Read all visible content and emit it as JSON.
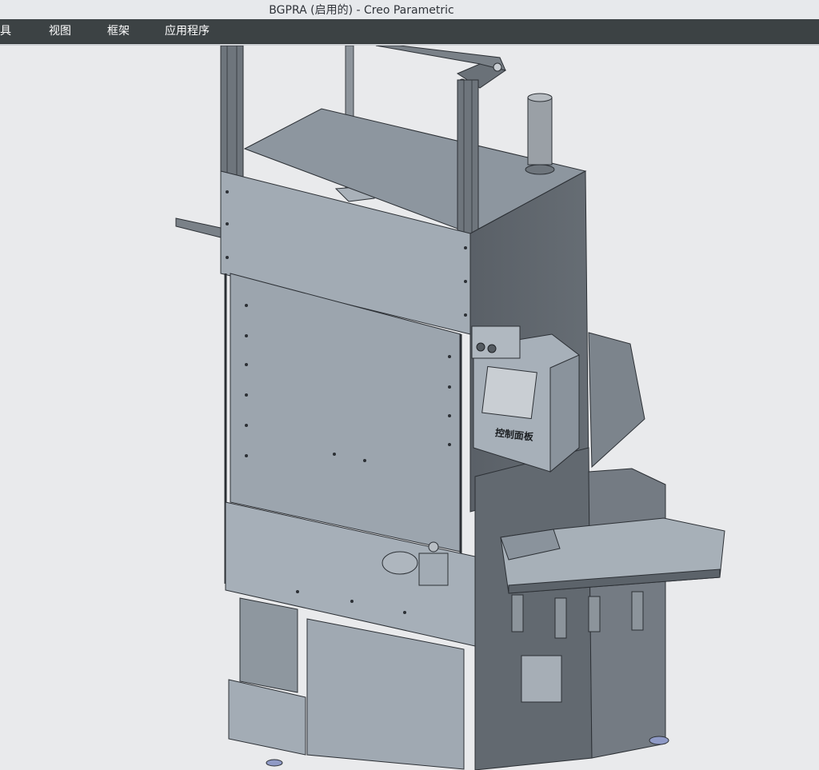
{
  "window": {
    "title": "BGPRA (启用的) - Creo Parametric"
  },
  "menubar": {
    "items": [
      {
        "label": "具"
      },
      {
        "label": "视图"
      },
      {
        "label": "框架"
      },
      {
        "label": "应用程序"
      }
    ]
  },
  "model": {
    "control_panel_label": "控制面板"
  },
  "colors": {
    "menubar_bg": "#3c4244",
    "viewport_bg": "#e9eaec",
    "panel_front": "#9ba4ae",
    "panel_side": "#5d636a"
  }
}
